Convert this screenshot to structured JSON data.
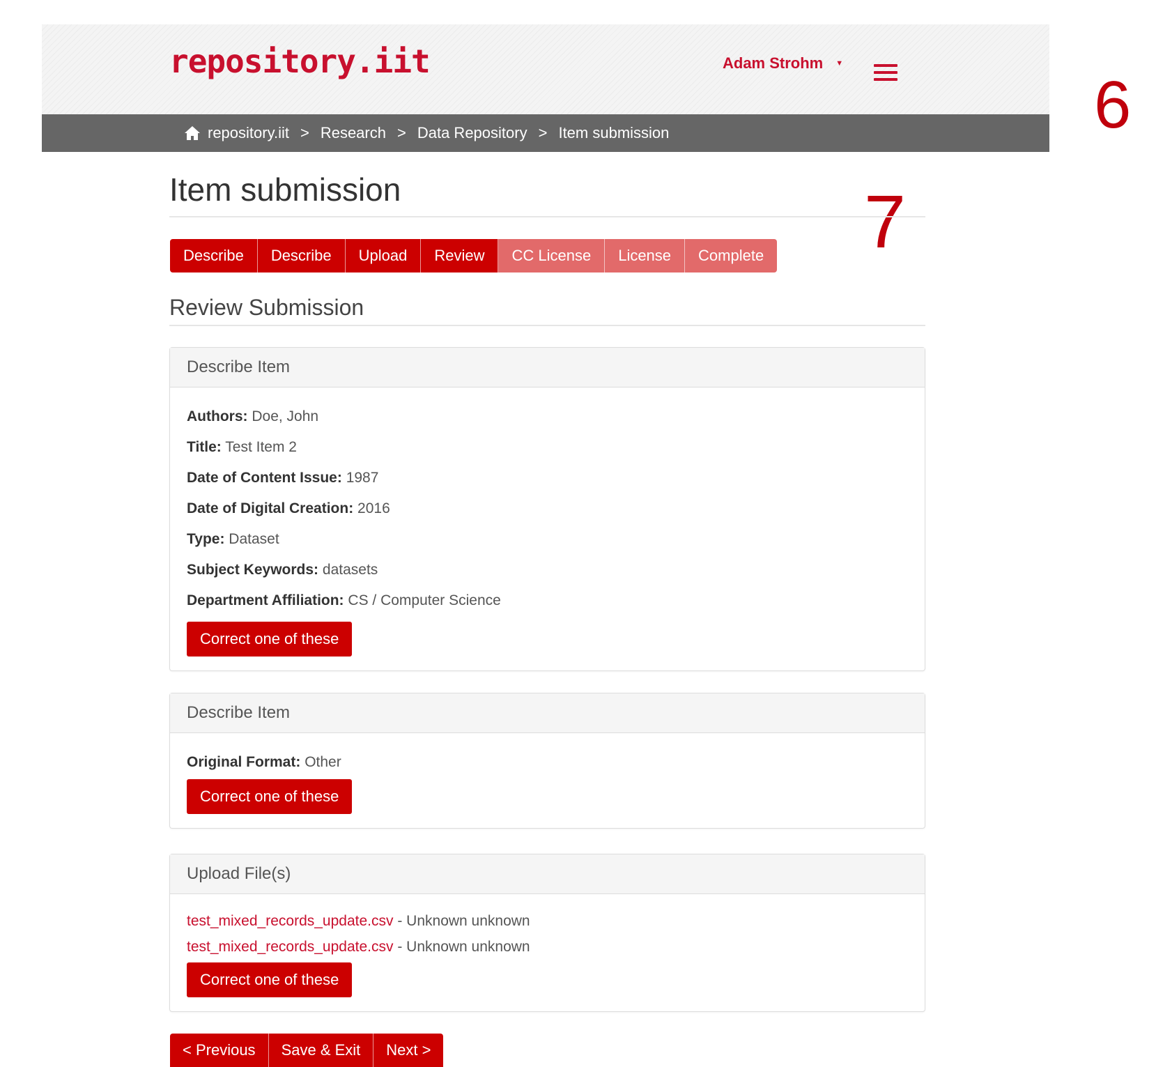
{
  "header": {
    "brand": "repository.iit",
    "user_name": "Adam Strohm",
    "icons": {
      "user_caret": "caret-down-icon",
      "menu": "hamburger-icon"
    }
  },
  "breadcrumb": {
    "home_icon": "home-icon",
    "items": [
      "repository.iit",
      "Research",
      "Data Repository",
      "Item submission"
    ],
    "separator": ">"
  },
  "annotations": {
    "left": "7",
    "right": "6"
  },
  "page": {
    "title": "Item submission",
    "section_title": "Review Submission"
  },
  "tabs": [
    {
      "label": "Describe",
      "state": "done"
    },
    {
      "label": "Describe",
      "state": "done"
    },
    {
      "label": "Upload",
      "state": "done"
    },
    {
      "label": "Review",
      "state": "current"
    },
    {
      "label": "CC License",
      "state": "pending"
    },
    {
      "label": "License",
      "state": "pending"
    },
    {
      "label": "Complete",
      "state": "pending"
    }
  ],
  "panels": [
    {
      "heading": "Describe Item",
      "fields": [
        {
          "label": "Authors:",
          "value": "Doe, John"
        },
        {
          "label": "Title:",
          "value": "Test Item 2"
        },
        {
          "label": "Date of Content Issue:",
          "value": "1987"
        },
        {
          "label": "Date of Digital Creation:",
          "value": "2016"
        },
        {
          "label": "Type:",
          "value": "Dataset"
        },
        {
          "label": "Subject Keywords:",
          "value": "datasets"
        },
        {
          "label": "Department Affiliation:",
          "value": "CS / Computer Science"
        }
      ],
      "button": "Correct one of these"
    },
    {
      "heading": "Describe Item",
      "fields": [
        {
          "label": "Original Format:",
          "value": "Other"
        }
      ],
      "button": "Correct one of these"
    },
    {
      "heading": "Upload File(s)",
      "files": [
        {
          "name": "test_mixed_records_update.csv",
          "detail": "- Unknown unknown"
        },
        {
          "name": "test_mixed_records_update.csv",
          "detail": "- Unknown unknown"
        }
      ],
      "button": "Correct one of these"
    }
  ],
  "nav": {
    "previous": "< Previous",
    "save_exit": "Save & Exit",
    "next": "Next >"
  },
  "colors": {
    "brand_red": "#cc0000",
    "pending_tab": "#e26a6a",
    "breadcrumb_bg": "#666666",
    "annotation": "#c0000c"
  }
}
